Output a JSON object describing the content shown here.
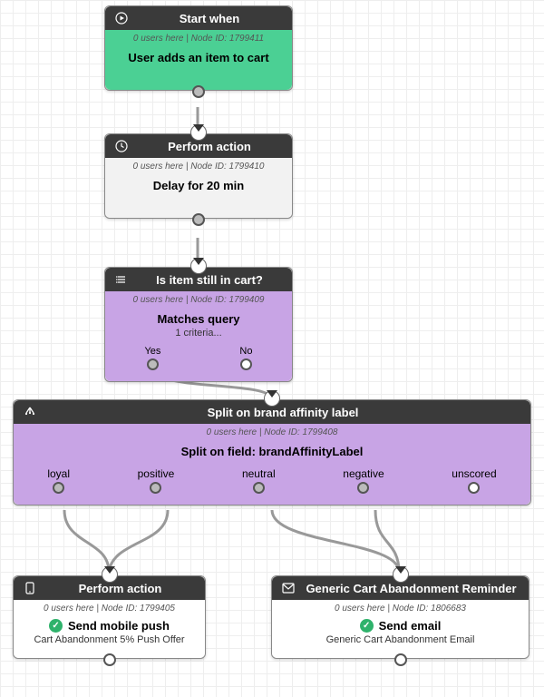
{
  "nodes": {
    "start": {
      "title": "Start when",
      "meta": "0 users here | Node ID: 1799411",
      "main": "User adds an item to cart"
    },
    "delay": {
      "title": "Perform action",
      "meta": "0 users here | Node ID: 1799410",
      "main": "Delay for 20 min"
    },
    "check": {
      "title": "Is item still in cart?",
      "meta": "0 users here | Node ID: 1799409",
      "main": "Matches query",
      "extra": "1 criteria...",
      "yes": "Yes",
      "no": "No"
    },
    "split": {
      "title": "Split on brand affinity label",
      "meta": "0 users here | Node ID: 1799408",
      "main": "Split on field: brandAffinityLabel",
      "branches": [
        "loyal",
        "positive",
        "neutral",
        "negative",
        "unscored"
      ]
    },
    "push": {
      "title": "Perform action",
      "meta": "0 users here | Node ID: 1799405",
      "action": "Send mobile push",
      "detail": "Cart Abandonment 5% Push Offer"
    },
    "email": {
      "title": "Generic Cart Abandonment Reminder",
      "meta": "0 users here | Node ID: 1806683",
      "action": "Send email",
      "detail": "Generic Cart Abandonment Email"
    }
  }
}
